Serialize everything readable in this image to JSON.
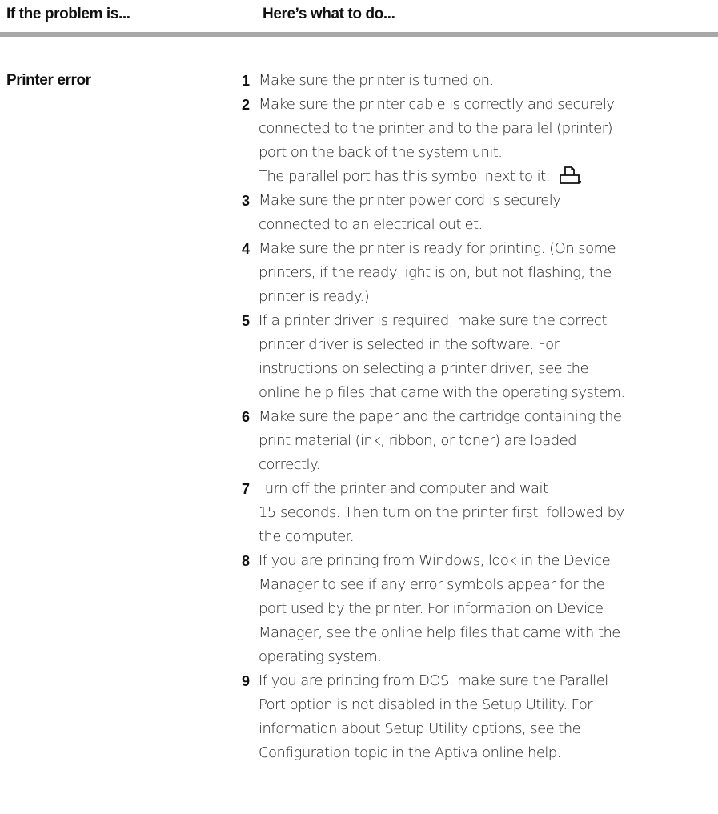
{
  "header": {
    "problem_col": "If the problem is...",
    "action_col": "Here’s what to do..."
  },
  "problem": {
    "label": "Printer error"
  },
  "steps": [
    {
      "num": "1",
      "lines": [
        "Make sure the printer is turned on."
      ]
    },
    {
      "num": "2",
      "lines": [
        "Make sure the printer cable is correctly and securely",
        "connected to the printer and to the parallel (printer)",
        "port on the back of the system unit.",
        "The parallel port has this symbol next to it:"
      ],
      "icon": "parallel-port-printer-icon"
    },
    {
      "num": "3",
      "lines": [
        "Make sure the printer power cord is securely",
        "connected to an electrical outlet."
      ]
    },
    {
      "num": "4",
      "lines": [
        "Make sure the printer is ready for printing. (On some",
        "printers, if the ready light is on, but not flashing, the",
        "printer is ready.)"
      ]
    },
    {
      "num": "5",
      "lines": [
        "If a printer driver is required, make sure the correct",
        "printer driver is selected in the software. For",
        "instructions on selecting a printer driver, see the",
        "online help files that came with the operating system."
      ]
    },
    {
      "num": "6",
      "lines": [
        "Make sure the paper and the cartridge containing the",
        "print material (ink, ribbon, or toner) are loaded",
        "correctly."
      ]
    },
    {
      "num": "7",
      "lines": [
        "Turn off the printer and computer and wait",
        "15 seconds. Then turn on the printer first, followed by",
        "the computer."
      ]
    },
    {
      "num": "8",
      "lines": [
        "If you are printing from Windows, look in the Device",
        "Manager to see if any error symbols appear for the",
        "port used by the printer. For information on Device",
        "Manager, see the online help files that came with the",
        "operating system."
      ]
    },
    {
      "num": "9",
      "lines": [
        "If you are printing from DOS, make sure the Parallel",
        "Port option is not disabled in the Setup Utility. For",
        "information about Setup Utility options, see the",
        "Configuration topic in the Aptiva online help."
      ]
    }
  ],
  "colors": {
    "rule": "#a8a8a8",
    "text": "#1f1f1f"
  }
}
